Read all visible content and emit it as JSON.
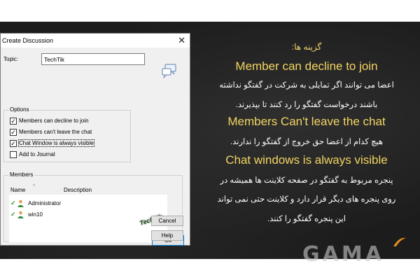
{
  "dialog": {
    "title": "Create Discussion",
    "topic_label": "Topic:",
    "topic_value": "TechTik",
    "options_title": "Options",
    "options": [
      {
        "label": "Members can decline to join",
        "checked": true
      },
      {
        "label": "Members can't leave the chat",
        "checked": true
      },
      {
        "label": "Chat Window is always visible",
        "checked": true
      },
      {
        "label": "Add to Journal",
        "checked": false
      }
    ],
    "members_title": "Members",
    "columns": [
      "Name",
      "Description"
    ],
    "members": [
      {
        "name": "Administrator"
      },
      {
        "name": "win10"
      }
    ],
    "buttons": {
      "ok": "Ok",
      "cancel": "Cancel",
      "help": "Help"
    },
    "watermark": "TechTik"
  },
  "panel": {
    "heading": "گزینه ها:",
    "items": [
      {
        "title": "Member can decline to join",
        "lines": [
          "اعضا می توانند اگر تمایلی به شرکت در گفتگو نداشته",
          "باشند درخواست گفتگو را رد کنند تا بپذیرند."
        ]
      },
      {
        "title": "Members Can't leave the chat",
        "lines": [
          "هیچ کدام از اعضا حق خروج از گفتگو را ندارند."
        ]
      },
      {
        "title": "Chat windows is always visible",
        "lines": [
          "پنجره مربوط به گفتگو در صفحه کلاینت ها همیشه در",
          "روی پنجره های دیگر قرار دارد و کلاینت حتی نمی تواند",
          "این پنجره گفتگو را کنند."
        ]
      }
    ]
  },
  "logo": {
    "text": "GAMA"
  },
  "colors": {
    "heading_yellow": "#f3d461",
    "board": "#1c1c1c",
    "check_green": "#2a9a2a"
  }
}
